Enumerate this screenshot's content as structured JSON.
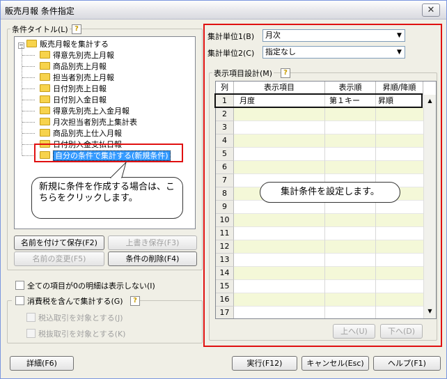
{
  "window": {
    "title": "販売月報 条件指定",
    "close": "✕"
  },
  "condition": {
    "title_label": "条件タイトル(L)",
    "tree_root": "販売月報を集計する",
    "tree_items": [
      "得意先別売上月報",
      "商品別売上月報",
      "担当者別売上月報",
      "日付別売上日報",
      "日付別入金日報",
      "得意先別売上入金月報",
      "月次担当者別売上集計表",
      "商品別売上仕入月報",
      "日付別入金支払日報",
      "自分の条件で集計する(新規条件)"
    ],
    "callout_text": "新規に条件を作成する場合は、こちらをクリックします。",
    "btn_save_as": "名前を付けて保存(F2)",
    "btn_overwrite": "上書き保存(F3)",
    "btn_rename": "名前の変更(F5)",
    "btn_delete": "条件の削除(F4)"
  },
  "options": {
    "hide_zero": "全ての項目が0の明細は表示しない(I)",
    "include_tax": "消費税を含んで集計する(G)",
    "tax_inclusive": "税込取引を対象とする(J)",
    "tax_exclusive": "税抜取引を対象とする(K)"
  },
  "unit": {
    "label1": "集計単位1(B)",
    "value1": "月次",
    "label2": "集計単位2(C)",
    "value2": "指定なし"
  },
  "display_items": {
    "label": "表示項目設計(M)",
    "columns": [
      "列",
      "表示項目",
      "表示順",
      "昇順/降順"
    ],
    "rows": [
      {
        "n": "1",
        "item": "月度",
        "order": "第１キー",
        "dir": "昇順"
      },
      {
        "n": "2",
        "item": "",
        "order": "",
        "dir": ""
      },
      {
        "n": "3",
        "item": "",
        "order": "",
        "dir": ""
      },
      {
        "n": "4",
        "item": "",
        "order": "",
        "dir": ""
      },
      {
        "n": "5",
        "item": "",
        "order": "",
        "dir": ""
      },
      {
        "n": "6",
        "item": "",
        "order": "",
        "dir": ""
      },
      {
        "n": "7",
        "item": "",
        "order": "",
        "dir": ""
      },
      {
        "n": "8",
        "item": "",
        "order": "",
        "dir": ""
      },
      {
        "n": "9",
        "item": "",
        "order": "",
        "dir": ""
      },
      {
        "n": "10",
        "item": "",
        "order": "",
        "dir": ""
      },
      {
        "n": "11",
        "item": "",
        "order": "",
        "dir": ""
      },
      {
        "n": "12",
        "item": "",
        "order": "",
        "dir": ""
      },
      {
        "n": "13",
        "item": "",
        "order": "",
        "dir": ""
      },
      {
        "n": "14",
        "item": "",
        "order": "",
        "dir": ""
      },
      {
        "n": "15",
        "item": "",
        "order": "",
        "dir": ""
      },
      {
        "n": "16",
        "item": "",
        "order": "",
        "dir": ""
      },
      {
        "n": "17",
        "item": "",
        "order": "",
        "dir": ""
      }
    ],
    "callout_text": "集計条件を設定します。",
    "btn_up": "上へ(U)",
    "btn_down": "下へ(D)"
  },
  "footer": {
    "detail": "詳細(F6)",
    "execute": "実行(F12)",
    "cancel": "キャンセル(Esc)",
    "help": "ヘルプ(F1)"
  },
  "colors": {
    "highlight": "#e8e8e8",
    "grid_band": "#f4f8d8",
    "red": "#e01010",
    "selected": "#3399ff"
  }
}
